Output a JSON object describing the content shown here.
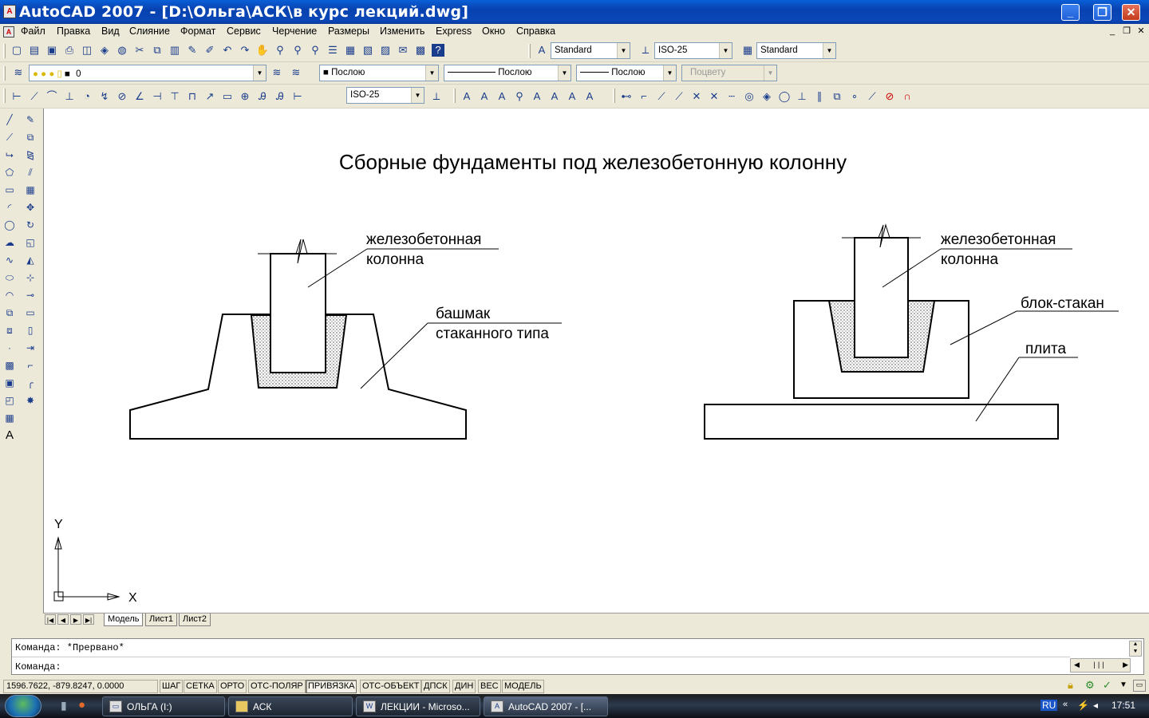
{
  "window": {
    "title": "AutoCAD 2007 - [D:\\Ольга\\АСК\\в курс лекций.dwg]"
  },
  "menu": [
    "Файл",
    "Правка",
    "Вид",
    "Слияние",
    "Формат",
    "Сервис",
    "Черчение",
    "Размеры",
    "Изменить",
    "Express",
    "Окно",
    "Справка"
  ],
  "toolbar": {
    "text_style": "Standard",
    "dim_style": "ISO-25",
    "table_style": "Standard",
    "layer": "0",
    "color": "Послою",
    "linetype": "Послою",
    "lineweight": "Послою",
    "plotstyle": "Поцвету",
    "dim_style_2": "ISO-25"
  },
  "drawing": {
    "title": "Сборные фундаменты под железобетонную колонну",
    "left": {
      "label1_line1": "железобетонная",
      "label1_line2": "колонна",
      "label2_line1": "башмак",
      "label2_line2": "стаканного типа"
    },
    "right": {
      "label1_line1": "железобетонная",
      "label1_line2": "колонна",
      "label2": "блок-стакан",
      "label3": "плита"
    },
    "ucs_y": "Y",
    "ucs_x": "X"
  },
  "tabs": [
    "Модель",
    "Лист1",
    "Лист2"
  ],
  "command": {
    "history": "Команда: *Прервано*",
    "prompt": "Команда:"
  },
  "status": {
    "coords": "1596.7622, -879.8247, 0.0000",
    "buttons": [
      {
        "label": "ШАГ",
        "on": false
      },
      {
        "label": "СЕТКА",
        "on": false
      },
      {
        "label": "ОРТО",
        "on": false
      },
      {
        "label": "ОТС-ПОЛЯР",
        "on": false
      },
      {
        "label": "ПРИВЯЗКА",
        "on": true
      },
      {
        "label": "ОТС-ОБЪЕКТ",
        "on": false
      },
      {
        "label": "ДПСК",
        "on": false
      },
      {
        "label": "ДИН",
        "on": false
      },
      {
        "label": "ВЕС",
        "on": false
      },
      {
        "label": "МОДЕЛЬ",
        "on": false
      }
    ]
  },
  "taskbar": {
    "items": [
      {
        "label": "ОЛЬГА (I:)",
        "active": false
      },
      {
        "label": "АСК",
        "active": false
      },
      {
        "label": "ЛЕКЦИИ - Microso...",
        "active": false
      },
      {
        "label": "AutoCAD 2007 - [...",
        "active": true
      }
    ],
    "lang": "RU",
    "clock": "17:51"
  }
}
